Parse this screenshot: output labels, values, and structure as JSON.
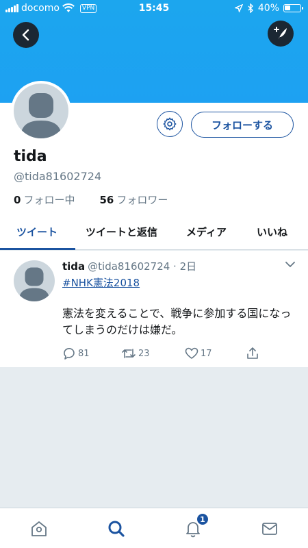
{
  "status_bar": {
    "carrier": "docomo",
    "vpn": "VPN",
    "time": "15:45",
    "battery": "40%",
    "battery_level": 0.4
  },
  "header": {
    "back_icon": "chevron-left-icon",
    "compose_icon": "compose-tweet-icon"
  },
  "profile": {
    "name": "tida",
    "handle": "@tida81602724",
    "following_count": "0",
    "following_label": "フォロー中",
    "followers_count": "56",
    "followers_label": "フォロワー",
    "follow_button": "フォローする",
    "settings_icon": "gear-icon"
  },
  "tabs": [
    {
      "label": "ツイート",
      "active": true
    },
    {
      "label": "ツイートと返信",
      "active": false
    },
    {
      "label": "メディア",
      "active": false
    },
    {
      "label": "いいね",
      "active": false
    }
  ],
  "tweet": {
    "name": "tida",
    "meta": "@tida81602724 · 2日",
    "hashtag": "#NHK憲法2018",
    "text": "憲法を変えることで、戦争に参加する国になってしまうのだけは嫌だ。",
    "replies": "81",
    "retweets": "23",
    "likes": "17"
  },
  "bottom_nav": {
    "items": [
      "home-icon",
      "search-icon",
      "bell-icon",
      "mail-icon"
    ],
    "notification_badge": "1"
  },
  "colors": {
    "header_blue": "#1da1f2",
    "accent": "#1b53a0",
    "background": "#e6ecf0"
  }
}
